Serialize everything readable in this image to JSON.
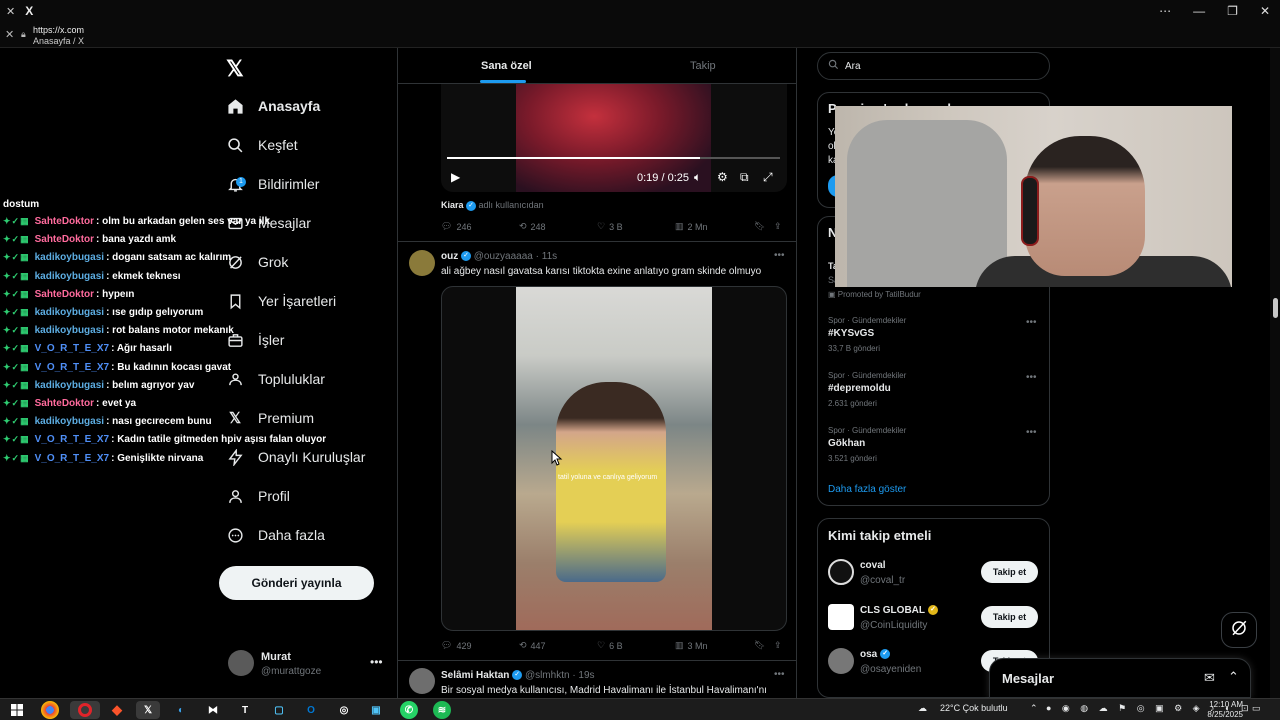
{
  "browser": {
    "tab_title": "X",
    "url": "https://x.com",
    "page_title": "Anasayfa / X"
  },
  "nav": {
    "items": [
      {
        "label": "Anasayfa",
        "icon": "home-icon"
      },
      {
        "label": "Keşfet",
        "icon": "search-icon"
      },
      {
        "label": "Bildirimler",
        "icon": "bell-icon",
        "badge": "1"
      },
      {
        "label": "Mesajlar",
        "icon": "mail-icon"
      },
      {
        "label": "Grok",
        "icon": "grok-icon"
      },
      {
        "label": "Yer İşaretleri",
        "icon": "bookmark-icon"
      },
      {
        "label": "İşler",
        "icon": "briefcase-icon"
      },
      {
        "label": "Topluluklar",
        "icon": "people-icon"
      },
      {
        "label": "Premium",
        "icon": "x-logo-icon"
      },
      {
        "label": "Onaylı Kuruluşlar",
        "icon": "lightning-icon"
      },
      {
        "label": "Profil",
        "icon": "person-icon"
      },
      {
        "label": "Daha fazla",
        "icon": "more-circle-icon"
      }
    ],
    "post_button": "Gönderi yayınla",
    "profile": {
      "name": "Murat",
      "handle": "@murattgoze"
    }
  },
  "chat": {
    "title": "dostum",
    "messages": [
      {
        "user": "SahteDoktor",
        "color": "#ff6b9d",
        "text": ": olm bu arkadan gelen ses var ya ilk"
      },
      {
        "user": "SahteDoktor",
        "color": "#ff6b9d",
        "text": ": bana yazdı amk"
      },
      {
        "user": "kadikoybugasi",
        "color": "#5dade2",
        "text": ": doganı satsam ac kalırım"
      },
      {
        "user": "kadikoybugasi",
        "color": "#5dade2",
        "text": ": ekmek teknesı"
      },
      {
        "user": "SahteDoktor",
        "color": "#ff6b9d",
        "text": ": hypeın"
      },
      {
        "user": "kadikoybugasi",
        "color": "#5dade2",
        "text": ": ıse gıdıp gelıyorum"
      },
      {
        "user": "kadikoybugasi",
        "color": "#5dade2",
        "text": ": rot balans motor mekanık"
      },
      {
        "user": "V_O_R_T_E_X7",
        "color": "#4f8ff7",
        "text": ": Ağır hasarlı"
      },
      {
        "user": "V_O_R_T_E_X7",
        "color": "#4f8ff7",
        "text": ": Bu kadının kocası gavat"
      },
      {
        "user": "kadikoybugasi",
        "color": "#5dade2",
        "text": ": belım agrıyor yav"
      },
      {
        "user": "SahteDoktor",
        "color": "#ff6b9d",
        "text": ": evet ya"
      },
      {
        "user": "kadikoybugasi",
        "color": "#5dade2",
        "text": ": nası gecırecem bunu"
      },
      {
        "user": "V_O_R_T_E_X7",
        "color": "#4f8ff7",
        "text": ": Kadın tatile gitmeden hpiv aşısı falan oluyor"
      },
      {
        "user": "V_O_R_T_E_X7",
        "color": "#4f8ff7",
        "text": ": Genişlikte nirvana"
      }
    ]
  },
  "timeline": {
    "tabs": [
      {
        "label": "Sana özel"
      },
      {
        "label": "Takip"
      }
    ],
    "post1": {
      "video_time": "0:19 / 0:25",
      "video_progress": 0.76,
      "quote_name": "Kiara",
      "quote_suffix": "adlı kullanıcıdan",
      "replies": "246",
      "reposts": "248",
      "likes": "3 B",
      "views": "2 Mn"
    },
    "post2": {
      "name": "ouz",
      "handle": "@ouzyaaaaa · 11s",
      "text": "ali ağbey nasıl gavatsa karısı tiktokta exine anlatıyo gram skinde olmuyo",
      "video_caption": "tatil yoluna ve canlıya geliyorum",
      "replies": "429",
      "reposts": "447",
      "likes": "6 B",
      "views": "3 Mn"
    },
    "post3": {
      "name": "Selâmi Haktan",
      "handle": "@slmhktn · 19s",
      "text": "Bir sosyal medya kullanıcısı, Madrid Havalimanı ile İstanbul Havalimanı'nı"
    }
  },
  "right": {
    "search_placeholder": "Ara",
    "card1": {
      "title": "Premium'a abone ol",
      "lines": [
        "Ye",
        "ol",
        "ka"
      ]
    },
    "card2": {
      "title": "N",
      "row_prefix": "Ta",
      "row_sub": "Sa"
    },
    "promoted": "Promoted by TatilBudur",
    "trends": [
      {
        "category": "Spor · Gündemdekiler",
        "name": "#KYSvGS",
        "count": "33,7 B gönderi"
      },
      {
        "category": "Spor · Gündemdekiler",
        "name": "#depremoldu",
        "count": "2.631 gönderi"
      },
      {
        "category": "Spor · Gündemdekiler",
        "name": "Gökhan",
        "count": "3.521 gönderi"
      }
    ],
    "show_more": "Daha fazla göster",
    "who_to_follow": {
      "title": "Kimi takip etmeli",
      "accounts": [
        {
          "name": "coval",
          "handle": "@coval_tr",
          "verified": ""
        },
        {
          "name": "CLS GLOBAL",
          "handle": "@CoinLiquidity",
          "verified": "gold"
        },
        {
          "name": "osa",
          "handle": "@osayeniden",
          "verified": "blue"
        }
      ],
      "follow_label": "Takip et"
    },
    "messages_drawer": "Mesajlar"
  },
  "taskbar": {
    "weather": "22°C  Çok bulutlu",
    "time": "12:10 AM",
    "date": "8/25/2025"
  },
  "colors": {
    "accent": "#1d9bf0",
    "background": "#000000",
    "border": "#2f3336",
    "muted": "#71767b"
  }
}
